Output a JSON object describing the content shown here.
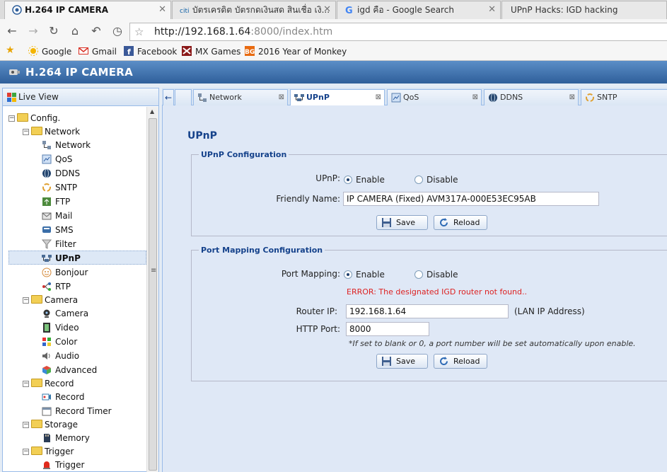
{
  "browser": {
    "tabs": [
      {
        "label": "H.264 IP CAMERA",
        "icon": "camera-icon"
      },
      {
        "label": "บัตรเครดิต บัตรกดเงินสด สินเชื่อ เงิ...",
        "icon": "citi-icon"
      },
      {
        "label": "igd คือ - Google Search",
        "icon": "google-icon"
      },
      {
        "label": "UPnP Hacks: IGD hacking",
        "icon": ""
      }
    ],
    "url_main": "http://192.168.1.64",
    "url_rest": ":8000/index.htm",
    "bookmarks": [
      "Google",
      "Gmail",
      "Facebook",
      "MX Games",
      "2016 Year of Monkey"
    ]
  },
  "app": {
    "title": "H.264 IP CAMERA"
  },
  "tree": {
    "header": "Live View",
    "nodes": [
      "Config.",
      "Network",
      "Network",
      "QoS",
      "DDNS",
      "SNTP",
      "FTP",
      "Mail",
      "SMS",
      "Filter",
      "UPnP",
      "Bonjour",
      "RTP",
      "Camera",
      "Camera",
      "Video",
      "Color",
      "Audio",
      "Advanced",
      "Record",
      "Record",
      "Record Timer",
      "Storage",
      "Memory",
      "Trigger",
      "Trigger"
    ]
  },
  "panel_tabs": [
    "Network",
    "UPnP",
    "QoS",
    "DDNS",
    "SNTP"
  ],
  "page": {
    "title": "UPnP",
    "upnp_config": {
      "legend": "UPnP Configuration",
      "upnp_label": "UPnP:",
      "enable": "Enable",
      "disable": "Disable",
      "friendly_label": "Friendly Name:",
      "friendly_value": "IP CAMERA (Fixed) AVM317A-000E53EC95AB",
      "save": "Save",
      "reload": "Reload"
    },
    "port_mapping": {
      "legend": "Port Mapping Configuration",
      "mapping_label": "Port Mapping:",
      "enable": "Enable",
      "disable": "Disable",
      "error": "ERROR: The designated IGD router not found..",
      "router_label": "Router IP:",
      "router_value": "192.168.1.64",
      "router_hint": "(LAN IP Address)",
      "http_label": "HTTP Port:",
      "http_value": "8000",
      "note": "*If set to blank or 0, a port number will be set automatically upon enable.",
      "save": "Save",
      "reload": "Reload"
    }
  }
}
